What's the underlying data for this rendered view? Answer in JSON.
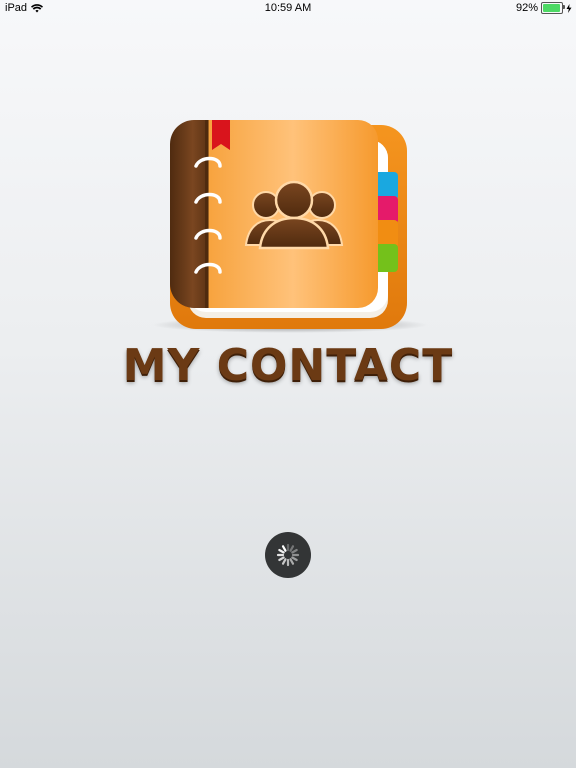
{
  "status_bar": {
    "device": "iPad",
    "time": "10:59 AM",
    "battery_percent": "92%",
    "battery_level": 0.92,
    "wifi_icon": "wifi-icon",
    "charging_icon": "lightning-icon"
  },
  "logo": {
    "icon": "address-book-contacts-icon",
    "colors": {
      "cover": "#f9a740",
      "spine": "#6d3f1c",
      "bookmark": "#d9141c",
      "tab_blue": "#1aa8e0",
      "tab_pink": "#e51a6a",
      "tab_orange": "#f18d12",
      "tab_green": "#74c11b"
    }
  },
  "app_title": "MY CONTACT",
  "loading": {
    "icon": "activity-spinner-icon"
  }
}
